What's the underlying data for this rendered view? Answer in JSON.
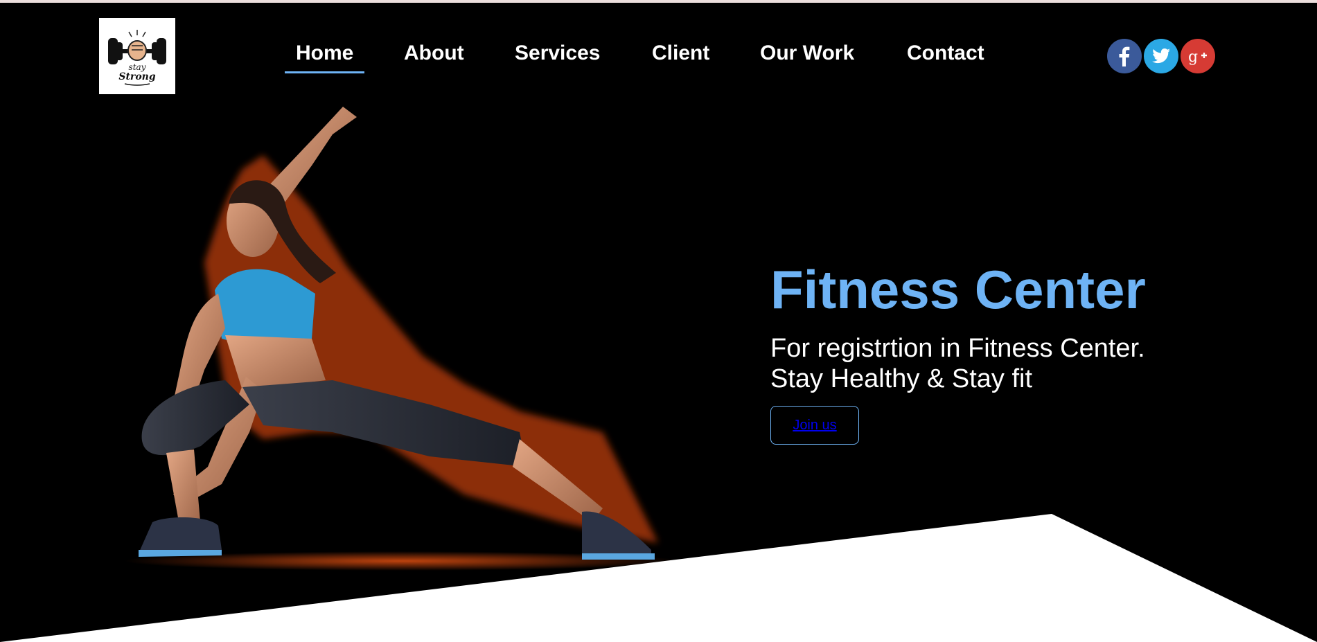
{
  "nav": {
    "items": [
      {
        "label": "Home",
        "active": true
      },
      {
        "label": "About",
        "active": false
      },
      {
        "label": "Services",
        "active": false
      },
      {
        "label": "Client",
        "active": false
      },
      {
        "label": "Our Work",
        "active": false
      },
      {
        "label": "Contact",
        "active": false
      }
    ]
  },
  "logo": {
    "text_line1": "stay",
    "text_line2": "Strong"
  },
  "social": [
    {
      "name": "facebook",
      "glyph": "f",
      "color": "#3b5a9a"
    },
    {
      "name": "twitter",
      "glyph": "🐦",
      "color": "#2ba8e5"
    },
    {
      "name": "google-plus",
      "glyph": "g+",
      "color": "#d63b34"
    }
  ],
  "hero": {
    "title": "Fitness Center",
    "subtitle_line1": "For registrtion in Fitness Center.",
    "subtitle_line2": "Stay Healthy & Stay fit",
    "cta_label": "Join us"
  },
  "colors": {
    "accent": "#6eb3f5",
    "background": "#000000",
    "text": "#ffffff"
  }
}
